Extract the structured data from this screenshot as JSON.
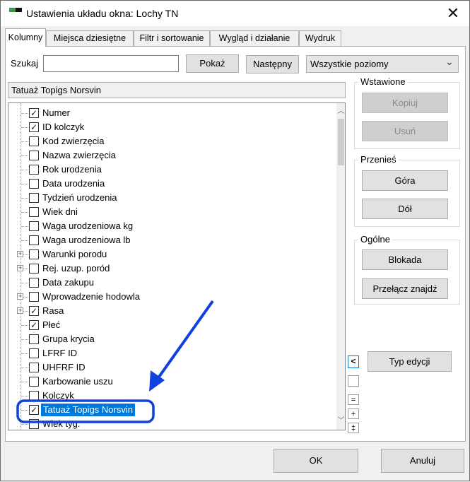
{
  "window": {
    "title": "Ustawienia układu okna: Lochy TN",
    "close_glyph": "✕"
  },
  "tabs": [
    {
      "label": "Kolumny"
    },
    {
      "label": "Miejsca dziesiętne"
    },
    {
      "label": "Filtr i sortowanie"
    },
    {
      "label": "Wygląd i działanie"
    },
    {
      "label": "Wydruk"
    }
  ],
  "search": {
    "label": "Szukaj",
    "value": "",
    "show_button": "Pokaż",
    "next_button": "Następny",
    "level_select": "Wszystkie poziomy"
  },
  "current_field": "Tatuaż Topigs Norsvin",
  "columns": [
    {
      "label": "Numer",
      "checked": true,
      "expandable": false
    },
    {
      "label": "ID kolczyk",
      "checked": true,
      "expandable": false
    },
    {
      "label": "Kod zwierzęcia",
      "checked": false,
      "expandable": false
    },
    {
      "label": "Nazwa zwierzęcia",
      "checked": false,
      "expandable": false
    },
    {
      "label": "Rok urodzenia",
      "checked": false,
      "expandable": false
    },
    {
      "label": "Data urodzenia",
      "checked": false,
      "expandable": false
    },
    {
      "label": "Tydzień urodzenia",
      "checked": false,
      "expandable": false
    },
    {
      "label": "Wiek dni",
      "checked": false,
      "expandable": false
    },
    {
      "label": "Waga urodzeniowa kg",
      "checked": false,
      "expandable": false
    },
    {
      "label": "Waga urodzeniowa lb",
      "checked": false,
      "expandable": false
    },
    {
      "label": "Warunki porodu",
      "checked": false,
      "expandable": true
    },
    {
      "label": "Rej. uzup. poród",
      "checked": false,
      "expandable": true
    },
    {
      "label": "Data zakupu",
      "checked": false,
      "expandable": false
    },
    {
      "label": "Wprowadzenie hodowla",
      "checked": false,
      "expandable": true
    },
    {
      "label": "Rasa",
      "checked": true,
      "expandable": true
    },
    {
      "label": "Płeć",
      "checked": true,
      "expandable": false
    },
    {
      "label": "Grupa krycia",
      "checked": false,
      "expandable": false
    },
    {
      "label": "LFRF ID",
      "checked": false,
      "expandable": false
    },
    {
      "label": "UHFRF ID",
      "checked": false,
      "expandable": false
    },
    {
      "label": "Karbowanie uszu",
      "checked": false,
      "expandable": false
    },
    {
      "label": "Kolczyk",
      "checked": false,
      "expandable": false
    },
    {
      "label": "Tatuaż Topigs Norsvin",
      "checked": true,
      "expandable": false,
      "selected": true
    },
    {
      "label": "Wiek tyg.",
      "checked": false,
      "expandable": false
    }
  ],
  "groups": {
    "inserted": {
      "label": "Wstawione",
      "copy": "Kopiuj",
      "remove": "Usuń"
    },
    "move": {
      "label": "Przenieś",
      "up": "Góra",
      "down": "Dół"
    },
    "general": {
      "label": "Ogólne",
      "lock": "Blokada",
      "toggle_found": "Przełącz znajdź"
    }
  },
  "edit_type_button": "Typ edycji",
  "side_controls": {
    "left": "<",
    "minus": "=",
    "plus": "+",
    "plusminus": "‡"
  },
  "footer": {
    "ok": "OK",
    "cancel": "Anuluj"
  },
  "colors": {
    "highlight": "#0078d7",
    "annotation": "#1040e0"
  }
}
